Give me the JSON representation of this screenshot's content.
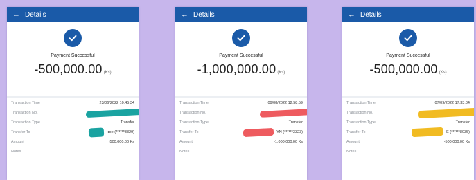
{
  "app": {
    "title": "Details",
    "back_icon": "arrow-left-icon"
  },
  "colors": {
    "appbar": "#1a5aa8",
    "background": "#c7b6ec",
    "redact_1": "#1aa3a1",
    "redact_2": "#ee5b5f",
    "redact_3": "#f1bb22"
  },
  "labels": {
    "status": "Payment Successful",
    "unit": "(Ks)",
    "transaction_time": "Transaction Time",
    "transaction_no": "Transaction No.",
    "transaction_type": "Transaction Type",
    "transfer_to": "Transfer To",
    "amount": "Amount",
    "notes": "Notes"
  },
  "receipts": [
    {
      "amount": "-500,000.00",
      "transaction_time": "23/06/2022 10:45:34",
      "transaction_type": "Transfer",
      "transfer_to": "ɪoe (******3329)",
      "amount_row": "-500,000.00 Ks"
    },
    {
      "amount": "-1,000,000.00",
      "transaction_time": "09/08/2022 12:58:59",
      "transaction_type": "Transfer",
      "transfer_to": "YN (******3323)",
      "amount_row": "-1,000,000.00 Ks"
    },
    {
      "amount": "-500,000.00",
      "transaction_time": "07/09/2022 17:33:04",
      "transaction_type": "Transfer",
      "transfer_to": "E (******8035)",
      "amount_row": "-500,000.00 Ks"
    }
  ]
}
